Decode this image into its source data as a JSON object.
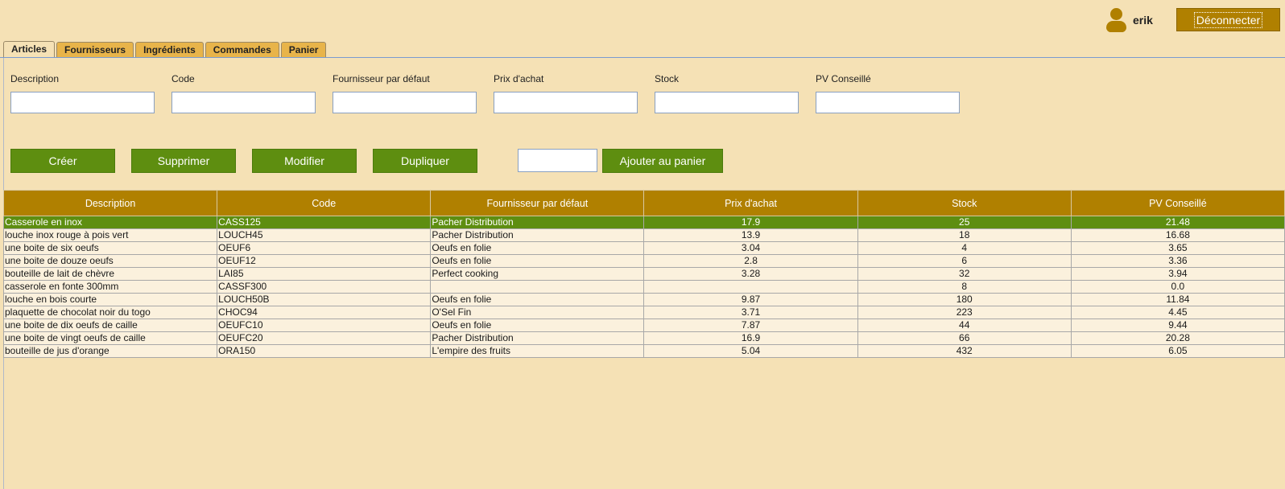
{
  "header": {
    "username": "erik",
    "logout_label": "Déconnecter"
  },
  "tabs": [
    {
      "label": "Articles",
      "active": true
    },
    {
      "label": "Fournisseurs",
      "active": false
    },
    {
      "label": "Ingrédients",
      "active": false
    },
    {
      "label": "Commandes",
      "active": false
    },
    {
      "label": "Panier",
      "active": false
    }
  ],
  "form": {
    "description": {
      "label": "Description",
      "value": ""
    },
    "code": {
      "label": "Code",
      "value": ""
    },
    "fournisseur": {
      "label": "Fournisseur par défaut",
      "value": ""
    },
    "prix_achat": {
      "label": "Prix d'achat",
      "value": ""
    },
    "stock": {
      "label": "Stock",
      "value": ""
    },
    "pv_conseille": {
      "label": "PV Conseillé",
      "value": ""
    }
  },
  "buttons": {
    "creer": "Créer",
    "supprimer": "Supprimer",
    "modifier": "Modifier",
    "dupliquer": "Dupliquer",
    "quantity_value": "",
    "ajouter_panier": "Ajouter au panier"
  },
  "table": {
    "columns": [
      "Description",
      "Code",
      "Fournisseur par défaut",
      "Prix d'achat",
      "Stock",
      "PV Conseillé"
    ],
    "selected_row": 0,
    "rows": [
      [
        "Casserole en inox",
        "CASS125",
        "Pacher Distribution",
        "17.9",
        "25",
        "21.48"
      ],
      [
        "louche inox rouge à pois vert",
        "LOUCH45",
        "Pacher Distribution",
        "13.9",
        "18",
        "16.68"
      ],
      [
        "une boite de six oeufs",
        "OEUF6",
        "Oeufs en folie",
        "3.04",
        "4",
        "3.65"
      ],
      [
        "une boite de douze oeufs",
        "OEUF12",
        "Oeufs en folie",
        "2.8",
        "6",
        "3.36"
      ],
      [
        "bouteille de lait de chèvre",
        "LAI85",
        "Perfect cooking",
        "3.28",
        "32",
        "3.94"
      ],
      [
        "casserole en fonte 300mm",
        "CASSF300",
        "",
        "",
        "8",
        "0.0"
      ],
      [
        "louche en bois courte",
        "LOUCH50B",
        "Oeufs en folie",
        "9.87",
        "180",
        "11.84"
      ],
      [
        "plaquette de chocolat noir du togo",
        "CHOC94",
        "O'Sel Fin",
        "3.71",
        "223",
        "4.45"
      ],
      [
        "une boite de dix oeufs de caille",
        "OEUFC10",
        "Oeufs en folie",
        "7.87",
        "44",
        "9.44"
      ],
      [
        "une boite de vingt oeufs de caille",
        "OEUFC20",
        "Pacher Distribution",
        "16.9",
        "66",
        "20.28"
      ],
      [
        "bouteille de jus d'orange",
        "ORA150",
        "L'empire des fruits",
        "5.04",
        "432",
        "6.05"
      ]
    ]
  }
}
